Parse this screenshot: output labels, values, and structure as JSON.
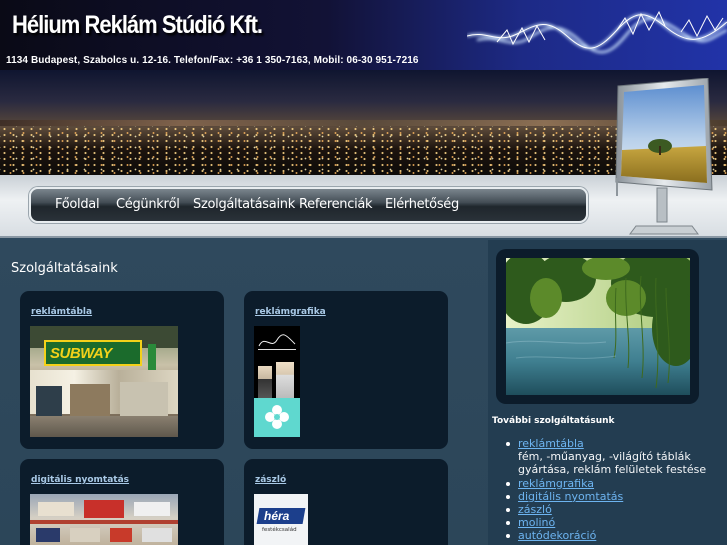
{
  "header": {
    "company_name": "Hélium Reklám Stúdió Kft.",
    "address": "1134 Budapest, Szabolcs u. 12-16. Telefon/Fax: +36 1 350-7163, Mobil: 06-30 951-7216"
  },
  "nav": {
    "items": [
      {
        "label": "Főoldal"
      },
      {
        "label": "Cégünkről"
      },
      {
        "label": "Szolgáltatásaink"
      },
      {
        "label": "Referenciák"
      },
      {
        "label": "Elérhetőség"
      }
    ]
  },
  "main": {
    "section_title": "Szolgáltatásaink",
    "cards": [
      {
        "link": "reklámtábla",
        "image": "subway-storefront"
      },
      {
        "link": "reklámgrafika",
        "image": "fashion-poster"
      },
      {
        "link": "digitális nyomtatás",
        "image": "building-signage"
      },
      {
        "link": "zászló",
        "image": "hera-flag",
        "image_text": "héra",
        "image_subtext": "festékcsalád"
      }
    ],
    "subway_sign": "SUBWAY"
  },
  "sidebar": {
    "photo": "lake-with-willow-trees",
    "title": "További szolgáltatásunk",
    "items": [
      {
        "link": "reklámtábla",
        "desc": "fém, -műanyag, -világító táblák gyártása, reklám felületek festése"
      },
      {
        "link": "reklámgrafika"
      },
      {
        "link": "digitális nyomtatás"
      },
      {
        "link": "zászló"
      },
      {
        "link": "molinó"
      },
      {
        "link": "autódekoráció"
      }
    ]
  },
  "colors": {
    "content_bg": "#2e4a5f",
    "card_bg": "#0c1c2b",
    "link": "#6db4f0",
    "nav_bar": "#2a3239"
  }
}
